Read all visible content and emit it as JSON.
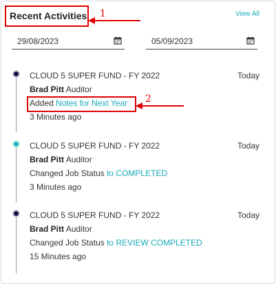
{
  "widget": {
    "title": "Recent Activities",
    "view_all": "View All"
  },
  "filters": {
    "date_from": "29/08/2023",
    "date_to": "05/09/2023"
  },
  "annotations": {
    "label1": "1",
    "label2": "2"
  },
  "activities": [
    {
      "title": "CLOUD 5 SUPER FUND - FY 2022",
      "time": "Today",
      "user_name": "Brad Pitt",
      "user_role": "Auditor",
      "action_prefix": "Added",
      "action_link": "Notes for Next Year",
      "ago": "3 Minutes ago"
    },
    {
      "title": "CLOUD 5 SUPER FUND - FY 2022",
      "time": "Today",
      "user_name": "Brad Pitt",
      "user_role": "Auditor",
      "action_prefix": "Changed Job Status",
      "action_link": "to COMPLETED",
      "ago": "3 Minutes ago"
    },
    {
      "title": "CLOUD 5 SUPER FUND - FY 2022",
      "time": "Today",
      "user_name": "Brad Pitt",
      "user_role": "Auditor",
      "action_prefix": "Changed Job Status",
      "action_link": "to REVIEW COMPLETED",
      "ago": "15 Minutes ago"
    }
  ],
  "colors": {
    "accent": "#16a9b8",
    "annotation": "#e00000",
    "dot_dark": "#101046",
    "dot_teal": "#18b8c4"
  }
}
